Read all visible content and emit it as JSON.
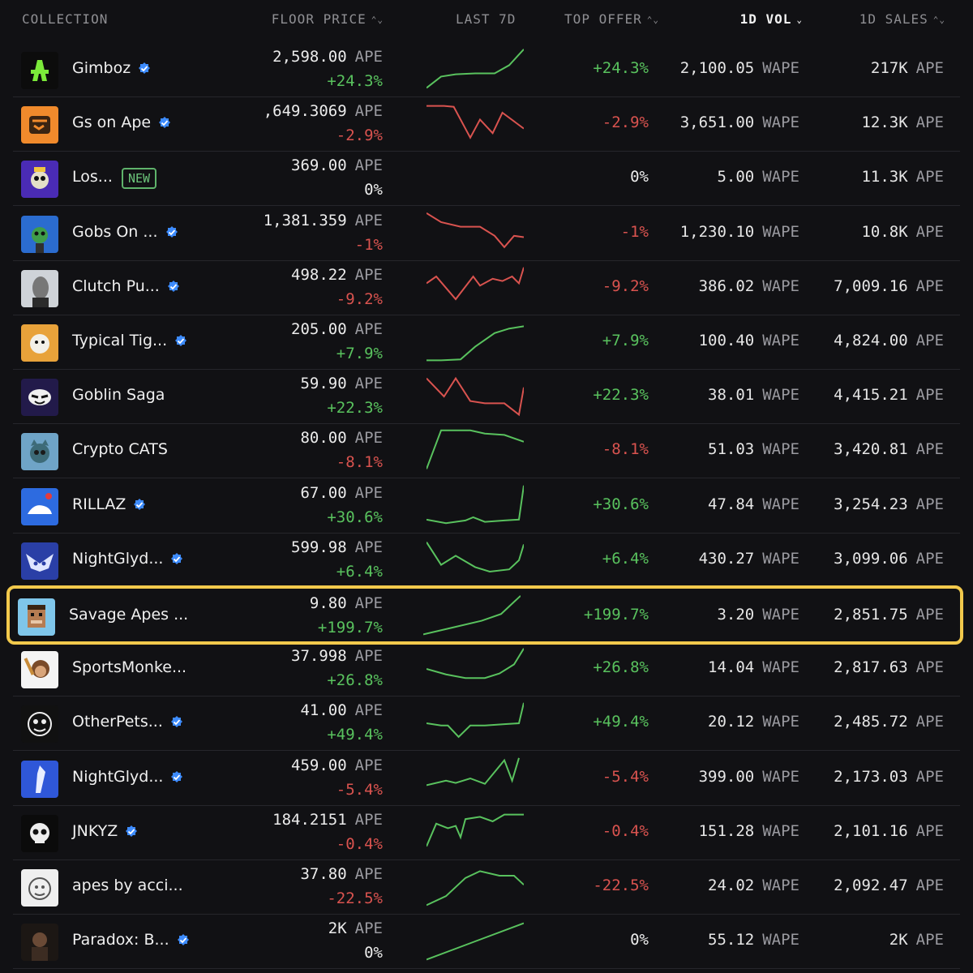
{
  "header": {
    "collection": "COLLECTION",
    "floor_price": "FLOOR PRICE",
    "last7d": "LAST 7D",
    "top_offer": "TOP OFFER",
    "vol1d": "1D VOL",
    "sales1d": "1D SALES",
    "sort_caret": "⌃⌄",
    "active_caret": "⌄"
  },
  "colors": {
    "positive": "#59c25e",
    "negative": "#d9534f",
    "highlight": "#f2c94c",
    "verified": "#3d8bfd"
  },
  "rows": [
    {
      "name": "Gimboz",
      "verified": true,
      "floor": "2,598.00",
      "floor_unit": "APE",
      "change": "+24.3%",
      "trend": "pos",
      "offer": "+24.3%",
      "vol": "2,100.05",
      "vol_unit": "WAPE",
      "sales": "217K",
      "sales_unit": "APE",
      "spark": [
        [
          0,
          90
        ],
        [
          15,
          65
        ],
        [
          30,
          60
        ],
        [
          50,
          58
        ],
        [
          70,
          58
        ],
        [
          85,
          40
        ],
        [
          100,
          5
        ]
      ],
      "avatar": "gimboz-icon"
    },
    {
      "name": "Gs on Ape",
      "verified": true,
      "floor": ",649.3069",
      "floor_unit": "APE",
      "change": "-2.9%",
      "trend": "neg",
      "offer": "-2.9%",
      "vol": "3,651.00",
      "vol_unit": "WAPE",
      "sales": "12.3K",
      "sales_unit": "APE",
      "spark": [
        [
          0,
          10
        ],
        [
          18,
          10
        ],
        [
          28,
          12
        ],
        [
          45,
          80
        ],
        [
          55,
          40
        ],
        [
          68,
          70
        ],
        [
          78,
          25
        ],
        [
          100,
          60
        ]
      ],
      "avatar": "gs-icon"
    },
    {
      "name": "Los...",
      "verified": false,
      "new_badge": "NEW",
      "floor": "369.00",
      "floor_unit": "APE",
      "change": "0%",
      "trend": "neu",
      "offer": "0%",
      "vol": "5.00",
      "vol_unit": "WAPE",
      "sales": "11.3K",
      "sales_unit": "APE",
      "spark": [],
      "avatar": "los-icon"
    },
    {
      "name": "Gobs On ...",
      "verified": true,
      "floor": "1,381.359",
      "floor_unit": "APE",
      "change": "-1%",
      "trend": "neg",
      "offer": "-1%",
      "vol": "1,230.10",
      "vol_unit": "WAPE",
      "sales": "10.8K",
      "sales_unit": "APE",
      "spark": [
        [
          0,
          5
        ],
        [
          15,
          25
        ],
        [
          35,
          35
        ],
        [
          55,
          35
        ],
        [
          70,
          55
        ],
        [
          80,
          80
        ],
        [
          90,
          55
        ],
        [
          100,
          58
        ]
      ],
      "avatar": "gobs-icon"
    },
    {
      "name": "Clutch Pu...",
      "verified": true,
      "floor": "498.22",
      "floor_unit": "APE",
      "change": "-9.2%",
      "trend": "neg",
      "offer": "-9.2%",
      "vol": "386.02",
      "vol_unit": "WAPE",
      "sales": "7,009.16",
      "sales_unit": "APE",
      "spark": [
        [
          0,
          40
        ],
        [
          10,
          25
        ],
        [
          22,
          55
        ],
        [
          30,
          75
        ],
        [
          48,
          25
        ],
        [
          55,
          45
        ],
        [
          68,
          30
        ],
        [
          78,
          35
        ],
        [
          88,
          25
        ],
        [
          95,
          40
        ],
        [
          100,
          5
        ]
      ],
      "avatar": "clutch-icon"
    },
    {
      "name": "Typical Tig...",
      "verified": true,
      "floor": "205.00",
      "floor_unit": "APE",
      "change": "+7.9%",
      "trend": "pos",
      "offer": "+7.9%",
      "vol": "100.40",
      "vol_unit": "WAPE",
      "sales": "4,824.00",
      "sales_unit": "APE",
      "spark": [
        [
          0,
          90
        ],
        [
          15,
          90
        ],
        [
          35,
          88
        ],
        [
          50,
          60
        ],
        [
          70,
          30
        ],
        [
          85,
          20
        ],
        [
          100,
          15
        ]
      ],
      "avatar": "tiger-icon"
    },
    {
      "name": "Goblin Saga",
      "verified": false,
      "floor": "59.90",
      "floor_unit": "APE",
      "change": "+22.3%",
      "trend": "pos",
      "offer": "+22.3%",
      "vol": "38.01",
      "vol_unit": "WAPE",
      "sales": "4,415.21",
      "sales_unit": "APE",
      "spark": [
        [
          0,
          10
        ],
        [
          18,
          50
        ],
        [
          30,
          10
        ],
        [
          45,
          60
        ],
        [
          60,
          65
        ],
        [
          80,
          65
        ],
        [
          95,
          90
        ],
        [
          100,
          30
        ]
      ],
      "avatar": "goblin-saga-icon",
      "spark_color": "neg"
    },
    {
      "name": "Crypto CATS",
      "verified": false,
      "floor": "80.00",
      "floor_unit": "APE",
      "change": "-8.1%",
      "trend": "neg",
      "offer": "-8.1%",
      "vol": "51.03",
      "vol_unit": "WAPE",
      "sales": "3,420.81",
      "sales_unit": "APE",
      "spark": [
        [
          0,
          90
        ],
        [
          15,
          5
        ],
        [
          45,
          5
        ],
        [
          60,
          12
        ],
        [
          80,
          15
        ],
        [
          100,
          30
        ]
      ],
      "avatar": "cats-icon",
      "spark_color": "pos"
    },
    {
      "name": "RILLAZ",
      "verified": true,
      "floor": "67.00",
      "floor_unit": "APE",
      "change": "+30.6%",
      "trend": "pos",
      "offer": "+30.6%",
      "vol": "47.84",
      "vol_unit": "WAPE",
      "sales": "3,254.23",
      "sales_unit": "APE",
      "spark": [
        [
          0,
          80
        ],
        [
          20,
          88
        ],
        [
          40,
          82
        ],
        [
          48,
          75
        ],
        [
          60,
          85
        ],
        [
          80,
          82
        ],
        [
          95,
          80
        ],
        [
          100,
          5
        ]
      ],
      "avatar": "rillaz-icon"
    },
    {
      "name": "NightGlyd...",
      "verified": true,
      "floor": "599.98",
      "floor_unit": "APE",
      "change": "+6.4%",
      "trend": "pos",
      "offer": "+6.4%",
      "vol": "430.27",
      "vol_unit": "WAPE",
      "sales": "3,099.06",
      "sales_unit": "APE",
      "spark": [
        [
          0,
          10
        ],
        [
          15,
          60
        ],
        [
          30,
          40
        ],
        [
          50,
          65
        ],
        [
          65,
          75
        ],
        [
          85,
          70
        ],
        [
          95,
          50
        ],
        [
          100,
          15
        ]
      ],
      "avatar": "nightglyder-icon"
    },
    {
      "name": "Savage Apes ...",
      "verified": false,
      "highlight": true,
      "floor": "9.80",
      "floor_unit": "APE",
      "change": "+199.7%",
      "trend": "pos",
      "offer": "+199.7%",
      "vol": "3.20",
      "vol_unit": "WAPE",
      "sales": "2,851.75",
      "sales_unit": "APE",
      "spark": [
        [
          0,
          90
        ],
        [
          30,
          75
        ],
        [
          60,
          60
        ],
        [
          80,
          45
        ],
        [
          100,
          5
        ]
      ],
      "avatar": "savage-apes-icon"
    },
    {
      "name": "SportsMonke...",
      "verified": false,
      "floor": "37.998",
      "floor_unit": "APE",
      "change": "+26.8%",
      "trend": "pos",
      "offer": "+26.8%",
      "vol": "14.04",
      "vol_unit": "WAPE",
      "sales": "2,817.63",
      "sales_unit": "APE",
      "spark": [
        [
          0,
          50
        ],
        [
          20,
          62
        ],
        [
          40,
          70
        ],
        [
          60,
          70
        ],
        [
          75,
          60
        ],
        [
          90,
          40
        ],
        [
          100,
          5
        ]
      ],
      "avatar": "sportsmonke-icon"
    },
    {
      "name": "OtherPets...",
      "verified": true,
      "floor": "41.00",
      "floor_unit": "APE",
      "change": "+49.4%",
      "trend": "pos",
      "offer": "+49.4%",
      "vol": "20.12",
      "vol_unit": "WAPE",
      "sales": "2,485.72",
      "sales_unit": "APE",
      "spark": [
        [
          0,
          50
        ],
        [
          15,
          55
        ],
        [
          22,
          55
        ],
        [
          33,
          80
        ],
        [
          45,
          55
        ],
        [
          60,
          55
        ],
        [
          80,
          52
        ],
        [
          95,
          50
        ],
        [
          100,
          5
        ]
      ],
      "avatar": "otherpets-icon"
    },
    {
      "name": "NightGlyd...",
      "verified": true,
      "floor": "459.00",
      "floor_unit": "APE",
      "change": "-5.4%",
      "trend": "neg",
      "offer": "-5.4%",
      "vol": "399.00",
      "vol_unit": "WAPE",
      "sales": "2,173.03",
      "sales_unit": "APE",
      "spark": [
        [
          0,
          65
        ],
        [
          20,
          55
        ],
        [
          30,
          60
        ],
        [
          45,
          50
        ],
        [
          60,
          62
        ],
        [
          80,
          10
        ],
        [
          88,
          55
        ],
        [
          95,
          5
        ]
      ],
      "avatar": "nightglyder2-icon",
      "spark_color": "pos"
    },
    {
      "name": "JNKYZ",
      "verified": true,
      "floor": "184.2151",
      "floor_unit": "APE",
      "change": "-0.4%",
      "trend": "neg",
      "offer": "-0.4%",
      "vol": "151.28",
      "vol_unit": "WAPE",
      "sales": "2,101.16",
      "sales_unit": "APE",
      "spark": [
        [
          0,
          80
        ],
        [
          10,
          30
        ],
        [
          22,
          40
        ],
        [
          30,
          35
        ],
        [
          35,
          60
        ],
        [
          40,
          20
        ],
        [
          55,
          15
        ],
        [
          68,
          25
        ],
        [
          80,
          10
        ],
        [
          100,
          10
        ]
      ],
      "avatar": "jnkyz-icon",
      "spark_color": "pos"
    },
    {
      "name": "apes by acci...",
      "verified": false,
      "floor": "37.80",
      "floor_unit": "APE",
      "change": "-22.5%",
      "trend": "neg",
      "offer": "-22.5%",
      "vol": "24.02",
      "vol_unit": "WAPE",
      "sales": "2,092.47",
      "sales_unit": "APE",
      "spark": [
        [
          0,
          90
        ],
        [
          20,
          70
        ],
        [
          40,
          30
        ],
        [
          55,
          15
        ],
        [
          75,
          25
        ],
        [
          90,
          25
        ],
        [
          100,
          45
        ]
      ],
      "avatar": "apes-acci-icon",
      "spark_color": "pos"
    },
    {
      "name": "Paradox: B...",
      "verified": true,
      "floor": "2K",
      "floor_unit": "APE",
      "change": "0%",
      "trend": "neu",
      "offer": "0%",
      "vol": "55.12",
      "vol_unit": "WAPE",
      "sales": "2K",
      "sales_unit": "APE",
      "spark": [
        [
          0,
          90
        ],
        [
          50,
          50
        ],
        [
          100,
          10
        ]
      ],
      "avatar": "paradox-icon",
      "spark_color": "pos"
    }
  ]
}
